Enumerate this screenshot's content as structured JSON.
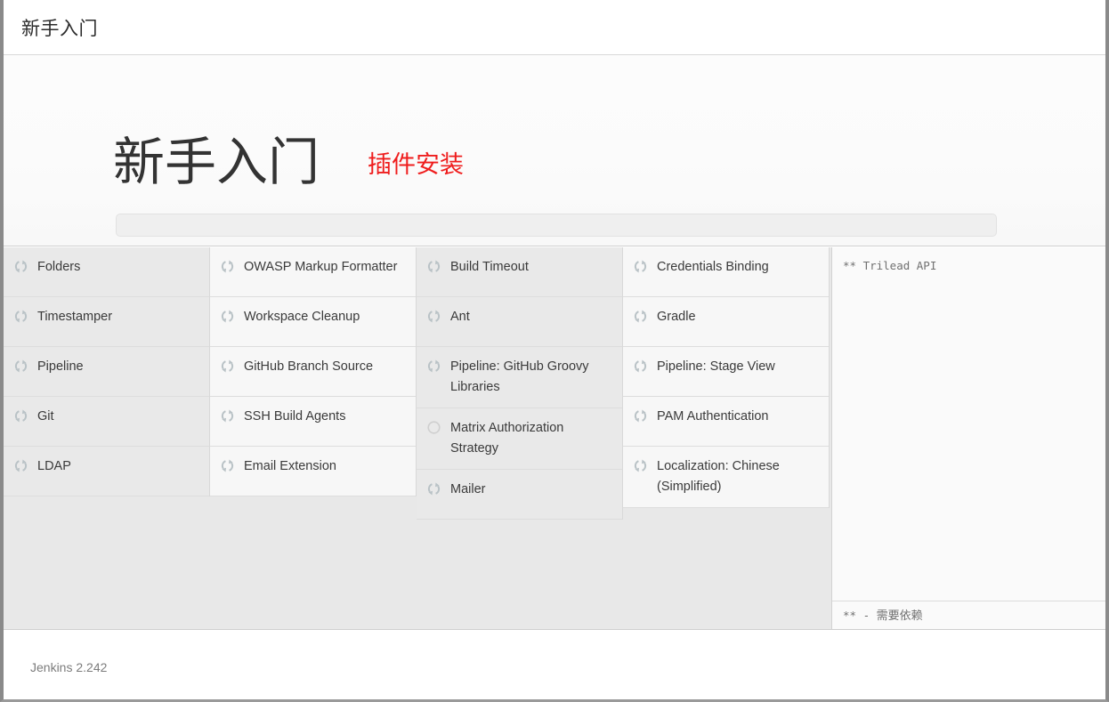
{
  "window": {
    "titlebar_label": "新手入门"
  },
  "wizard": {
    "title": "新手入门",
    "subtitle": "插件安装",
    "progress": {
      "percent": 0,
      "value_label": "0"
    }
  },
  "colors": {
    "subtitle_red": "#ef1d1d",
    "title_dark": "#333333",
    "column_shade_a": "#e9e9e9",
    "column_shade_b": "#f7f7f7",
    "body_gray": "#e8e8e8",
    "progress_track": "#efefef"
  },
  "install": {
    "columns": [
      {
        "shade": "a",
        "items": [
          {
            "name": "Folders",
            "status_icon": "spinner-icon",
            "status": "installing"
          },
          {
            "name": "Timestamper",
            "status_icon": "spinner-icon",
            "status": "installing"
          },
          {
            "name": "Pipeline",
            "status_icon": "spinner-icon",
            "status": "installing"
          },
          {
            "name": "Git",
            "status_icon": "spinner-icon",
            "status": "installing"
          },
          {
            "name": "LDAP",
            "status_icon": "spinner-icon",
            "status": "installing"
          }
        ]
      },
      {
        "shade": "b",
        "items": [
          {
            "name": "OWASP Markup Formatter",
            "status_icon": "spinner-icon",
            "status": "installing"
          },
          {
            "name": "Workspace Cleanup",
            "status_icon": "spinner-icon",
            "status": "installing"
          },
          {
            "name": "GitHub Branch Source",
            "status_icon": "spinner-icon",
            "status": "installing"
          },
          {
            "name": "SSH Build Agents",
            "status_icon": "spinner-icon",
            "status": "installing"
          },
          {
            "name": "Email Extension",
            "status_icon": "spinner-icon",
            "status": "installing"
          }
        ]
      },
      {
        "shade": "a",
        "items": [
          {
            "name": "Build Timeout",
            "status_icon": "spinner-icon",
            "status": "installing"
          },
          {
            "name": "Ant",
            "status_icon": "spinner-icon",
            "status": "installing"
          },
          {
            "name": "Pipeline: GitHub Groovy Libraries",
            "status_icon": "spinner-icon",
            "status": "installing"
          },
          {
            "name": "Matrix Authorization Strategy",
            "status_icon": "pending-circle-icon",
            "status": "pending"
          },
          {
            "name": "Mailer",
            "status_icon": "spinner-icon",
            "status": "installing"
          }
        ]
      },
      {
        "shade": "b",
        "items": [
          {
            "name": "Credentials Binding",
            "status_icon": "spinner-icon",
            "status": "installing"
          },
          {
            "name": "Gradle",
            "status_icon": "spinner-icon",
            "status": "installing"
          },
          {
            "name": "Pipeline: Stage View",
            "status_icon": "spinner-icon",
            "status": "installing"
          },
          {
            "name": "PAM Authentication",
            "status_icon": "spinner-icon",
            "status": "installing"
          },
          {
            "name": "Localization: Chinese (Simplified)",
            "status_icon": "spinner-icon",
            "status": "installing"
          }
        ]
      }
    ],
    "log": {
      "lines": [
        "** Trilead API"
      ],
      "footnote": "** - 需要依赖"
    }
  },
  "footer": {
    "version": "Jenkins 2.242"
  }
}
